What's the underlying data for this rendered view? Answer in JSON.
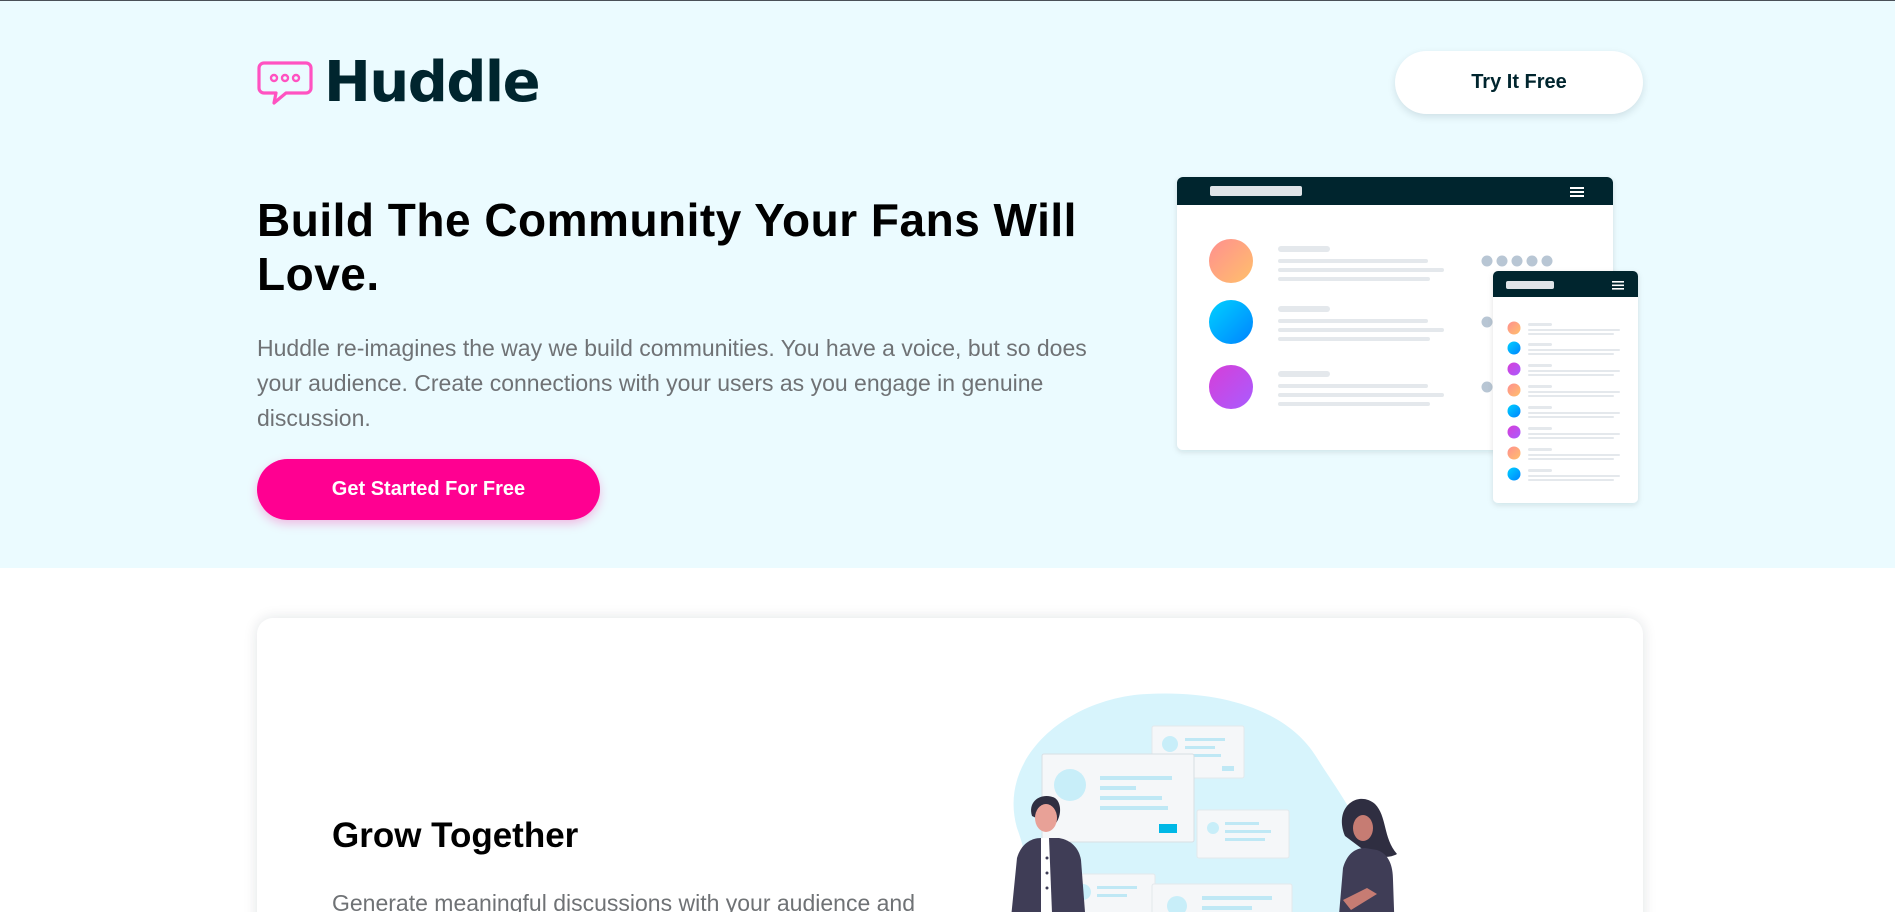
{
  "header": {
    "brand_name": "Huddle",
    "logo_icon": "speech-bubble-icon",
    "try_button_label": "Try It Free"
  },
  "hero": {
    "title": "Build The Community Your Fans Will Love.",
    "description": "Huddle re-imagines the way we build communities. You have a voice, but so does your audience. Create connections with your users as you engage in genuine discussion.",
    "cta_label": "Get Started For Free"
  },
  "features": [
    {
      "title": "Grow Together",
      "description": "Generate meaningful discussions with your audience and"
    }
  ],
  "colors": {
    "hero_background": "#ebfbff",
    "brand_dark": "#00252e",
    "accent_pink": "#ff0091",
    "gradient_orange": "#ff8f8f",
    "gradient_blue": "#00b8ff",
    "gradient_purple": "#d63ed8"
  }
}
